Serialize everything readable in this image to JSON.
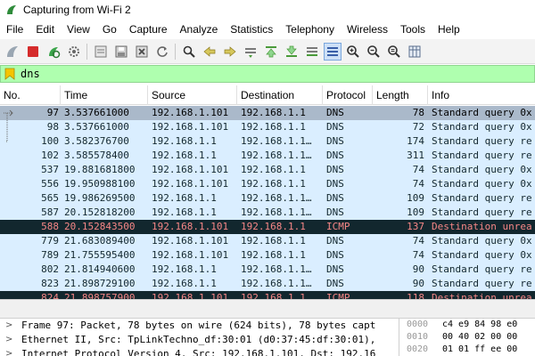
{
  "window": {
    "title": "Capturing from Wi-Fi 2"
  },
  "menu": [
    "File",
    "Edit",
    "View",
    "Go",
    "Capture",
    "Analyze",
    "Statistics",
    "Telephony",
    "Wireless",
    "Tools",
    "Help"
  ],
  "toolbar": {
    "icons": [
      "shark-fin-start-icon",
      "stop-square-icon",
      "restart-capture-icon",
      "capture-options-gear-icon",
      "open-file-icon",
      "save-file-icon",
      "close-file-icon",
      "reload-icon",
      "find-packet-icon",
      "go-back-icon",
      "go-forward-icon",
      "go-to-packet-icon",
      "go-first-icon",
      "go-last-icon",
      "autoscroll-icon",
      "colorize-icon",
      "zoom-in-icon",
      "zoom-out-icon",
      "zoom-normal-icon",
      "resize-columns-icon"
    ]
  },
  "filter": {
    "value": "dns"
  },
  "packet_list": {
    "columns": [
      "No.",
      "Time",
      "Source",
      "Destination",
      "Protocol",
      "Length",
      "Info"
    ],
    "rows": [
      {
        "no": "97",
        "time": "3.537661000",
        "src": "192.168.1.101",
        "dst": "192.168.1.1",
        "proto": "DNS",
        "len": "78",
        "info": "Standard query 0x",
        "style": "sel"
      },
      {
        "no": "98",
        "time": "3.537661000",
        "src": "192.168.1.101",
        "dst": "192.168.1.1",
        "proto": "DNS",
        "len": "72",
        "info": "Standard query 0x",
        "style": "dns"
      },
      {
        "no": "100",
        "time": "3.582376700",
        "src": "192.168.1.1",
        "dst": "192.168.1.1…",
        "proto": "DNS",
        "len": "174",
        "info": "Standard query re",
        "style": "dns"
      },
      {
        "no": "102",
        "time": "3.585578400",
        "src": "192.168.1.1",
        "dst": "192.168.1.1…",
        "proto": "DNS",
        "len": "311",
        "info": "Standard query re",
        "style": "dns"
      },
      {
        "no": "537",
        "time": "19.881681800",
        "src": "192.168.1.101",
        "dst": "192.168.1.1",
        "proto": "DNS",
        "len": "74",
        "info": "Standard query 0x",
        "style": "dns"
      },
      {
        "no": "556",
        "time": "19.950988100",
        "src": "192.168.1.101",
        "dst": "192.168.1.1",
        "proto": "DNS",
        "len": "74",
        "info": "Standard query 0x",
        "style": "dns"
      },
      {
        "no": "565",
        "time": "19.986269500",
        "src": "192.168.1.1",
        "dst": "192.168.1.1…",
        "proto": "DNS",
        "len": "109",
        "info": "Standard query re",
        "style": "dns"
      },
      {
        "no": "587",
        "time": "20.152818200",
        "src": "192.168.1.1",
        "dst": "192.168.1.1…",
        "proto": "DNS",
        "len": "109",
        "info": "Standard query re",
        "style": "dns"
      },
      {
        "no": "588",
        "time": "20.152843500",
        "src": "192.168.1.101",
        "dst": "192.168.1.1",
        "proto": "ICMP",
        "len": "137",
        "info": "Destination unrea",
        "style": "icmp"
      },
      {
        "no": "779",
        "time": "21.683089400",
        "src": "192.168.1.101",
        "dst": "192.168.1.1",
        "proto": "DNS",
        "len": "74",
        "info": "Standard query 0x",
        "style": "dns"
      },
      {
        "no": "789",
        "time": "21.755595400",
        "src": "192.168.1.101",
        "dst": "192.168.1.1",
        "proto": "DNS",
        "len": "74",
        "info": "Standard query 0x",
        "style": "dns"
      },
      {
        "no": "802",
        "time": "21.814940600",
        "src": "192.168.1.1",
        "dst": "192.168.1.1…",
        "proto": "DNS",
        "len": "90",
        "info": "Standard query re",
        "style": "dns"
      },
      {
        "no": "823",
        "time": "21.898729100",
        "src": "192.168.1.1",
        "dst": "192.168.1.1…",
        "proto": "DNS",
        "len": "90",
        "info": "Standard query re",
        "style": "dns"
      },
      {
        "no": "824",
        "time": "21.898757900",
        "src": "192.168.1.101",
        "dst": "192.168.1.1",
        "proto": "ICMP",
        "len": "118",
        "info": "Destination unrea",
        "style": "icmp"
      }
    ]
  },
  "details": [
    "Frame 97: Packet, 78 bytes on wire (624 bits), 78 bytes capt",
    "Ethernet II, Src: TpLinkTechno_df:30:01 (d0:37:45:df:30:01),",
    "Internet Protocol Version 4, Src: 192.168.1.101, Dst: 192.16"
  ],
  "bytes": [
    {
      "offset": "0000",
      "hex": "c4 e9 84 98 e0"
    },
    {
      "offset": "0010",
      "hex": "00 40 02 00 00"
    },
    {
      "offset": "0020",
      "hex": "01 01 ff ee 00"
    }
  ],
  "colors": {
    "dns_row": "#daeeff",
    "selected_row": "#aab9ca",
    "icmp_row_bg": "#12272e",
    "icmp_row_fg": "#f78787",
    "filter_ok": "#afffaf"
  }
}
